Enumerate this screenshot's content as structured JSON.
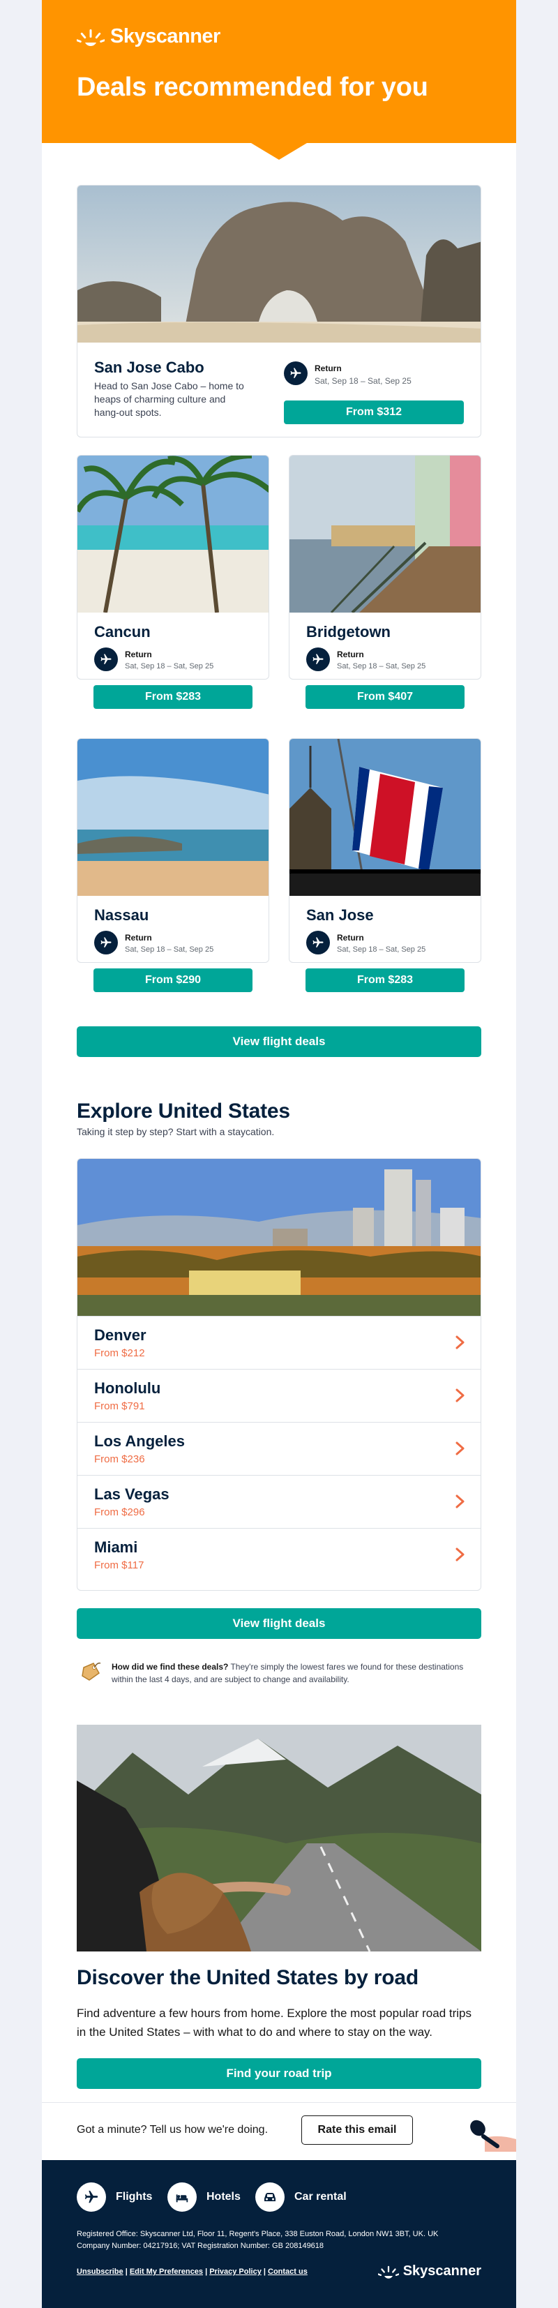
{
  "brand": {
    "name": "Skyscanner",
    "accent": "#00a698",
    "header_color": "#ff9400",
    "navy": "#05203c"
  },
  "hero": {
    "title": "Deals recommended for you"
  },
  "featured": {
    "city": "San Jose Cabo",
    "description": "Head to San Jose Cabo – home to heaps of charming culture and hang-out spots.",
    "trip_type": "Return",
    "dates": "Sat, Sep 18 – Sat, Sep 25",
    "price": "From $312"
  },
  "deals": [
    {
      "city": "Cancun",
      "trip_type": "Return",
      "dates": "Sat, Sep 18 – Sat, Sep 25",
      "price": "From $283"
    },
    {
      "city": "Bridgetown",
      "trip_type": "Return",
      "dates": "Sat, Sep 18 – Sat, Sep 25",
      "price": "From $407"
    },
    {
      "city": "Nassau",
      "trip_type": "Return",
      "dates": "Sat, Sep 18 – Sat, Sep 25",
      "price": "From $290"
    },
    {
      "city": "San Jose",
      "trip_type": "Return",
      "dates": "Sat, Sep 18 – Sat, Sep 25",
      "price": "From $283"
    }
  ],
  "view_deals_label": "View flight deals",
  "explore": {
    "title": "Explore United States",
    "subtitle": "Taking it step by step? Start with a staycation.",
    "cities": [
      {
        "name": "Denver",
        "price": "From $212"
      },
      {
        "name": "Honolulu",
        "price": "From $791"
      },
      {
        "name": "Los Angeles",
        "price": "From $236"
      },
      {
        "name": "Las Vegas",
        "price": "From $296"
      },
      {
        "name": "Miami",
        "price": "From $117"
      }
    ]
  },
  "note": {
    "question": "How did we find these deals?",
    "answer": " They're simply the lowest fares we found for these destinations within the last 4 days, and are subject to change and availability."
  },
  "road": {
    "title": "Discover the United States by road",
    "body": "Find adventure a few hours from home. Explore the most popular road trips in the United States – with what to do and where to stay on the way.",
    "cta": "Find your road trip"
  },
  "rate": {
    "prompt": "Got a minute? Tell us how we're doing.",
    "button": "Rate this email"
  },
  "footer": {
    "links": [
      "Flights",
      "Hotels",
      "Car rental"
    ],
    "legal_line1": "Registered Office: Skyscanner Ltd, Floor 11, Regent's Place, 338 Euston Road, London NW1 3BT, UK. UK",
    "legal_line2": "Company Number: 04217916; VAT Registration Number: GB 208149618",
    "bottom_links": [
      "Unsubscribe",
      "Edit My Preferences",
      "Privacy Policy",
      "Contact us"
    ],
    "separator": "|"
  }
}
